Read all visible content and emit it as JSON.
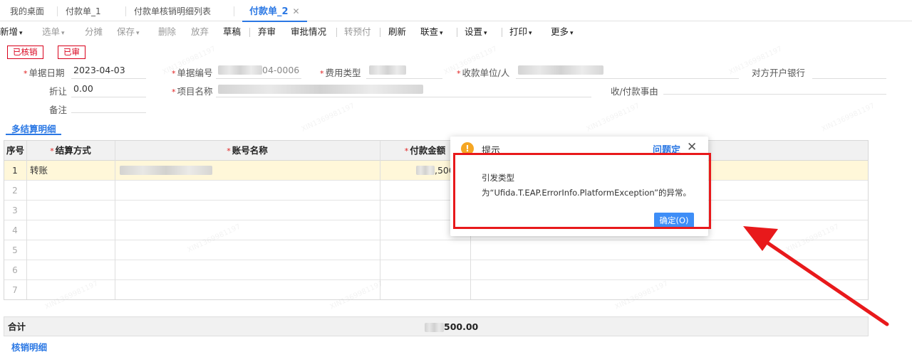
{
  "tabs": [
    {
      "label": "我的桌面"
    },
    {
      "label": "付款单_1"
    },
    {
      "label": "付款单核销明细列表"
    },
    {
      "label": "付款单_2",
      "close": "✕"
    }
  ],
  "toolbar": {
    "new": "新增",
    "select_doc": "选单",
    "split": "分摊",
    "save": "保存",
    "delete": "删除",
    "abandon": "放弃",
    "draft": "草稿",
    "unreview": "弃审",
    "approval": "审批情况",
    "to_prepay": "转预付",
    "refresh": "刷新",
    "link_query": "联查",
    "settings": "设置",
    "print": "打印",
    "more": "更多",
    "caret": "▾"
  },
  "status": {
    "verified": "已核销",
    "reviewed": "已审"
  },
  "form": {
    "doc_date_label": "单据日期",
    "doc_date": "2023-04-03",
    "doc_no_label": "单据编号",
    "doc_no_tail": "04-0006",
    "fee_type_label": "费用类型",
    "payee_label": "收款单位/人",
    "bank_label": "对方开户银行",
    "discount_label": "折让",
    "discount": "0.00",
    "project_label": "项目名称",
    "reason_label": "收/付款事由",
    "remark_label": "备注",
    "req": "*"
  },
  "section": {
    "multi_settle": "多结算明细",
    "writeoff": "核销明细"
  },
  "grid": {
    "headers": {
      "seq": "序号",
      "method": "结算方式",
      "account": "账号名称",
      "amount": "付款金额"
    },
    "rows": [
      {
        "num": "1",
        "method": "转账",
        "amount_tail": ",500"
      },
      {
        "num": "2"
      },
      {
        "num": "3"
      },
      {
        "num": "4"
      },
      {
        "num": "5"
      },
      {
        "num": "6"
      },
      {
        "num": "7"
      }
    ]
  },
  "total": {
    "label": "合计",
    "value_tail": "500.00"
  },
  "dialog": {
    "icon": "!",
    "title": "提示",
    "link": "问题定",
    "close": "✕",
    "message_line1": "引发类型",
    "message_line2": "为“Ufida.T.EAP.ErrorInfo.PlatformException”的异常。",
    "ok": "确定(O)"
  },
  "colors": {
    "accent": "#2b78e4",
    "alert_red": "#e8191b",
    "selected_row": "#fff7d9",
    "warn_icon": "#f5a623"
  }
}
